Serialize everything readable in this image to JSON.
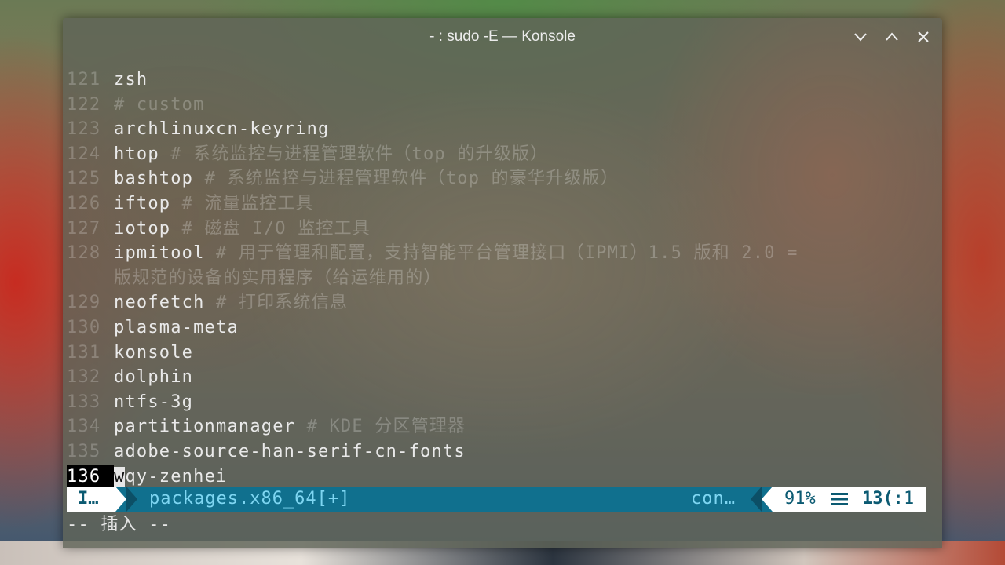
{
  "window": {
    "title": "- : sudo -E — Konsole",
    "controls": [
      "minimize",
      "maximize",
      "close"
    ]
  },
  "editor": {
    "lines": [
      {
        "num": "121",
        "text": "zsh",
        "comment": ""
      },
      {
        "num": "122",
        "text": "",
        "comment": "# custom"
      },
      {
        "num": "123",
        "text": "archlinuxcn-keyring",
        "comment": ""
      },
      {
        "num": "124",
        "text": "htop",
        "comment": " # 系统监控与进程管理软件（top 的升级版）"
      },
      {
        "num": "125",
        "text": "bashtop",
        "comment": " # 系统监控与进程管理软件（top 的豪华升级版）"
      },
      {
        "num": "126",
        "text": "iftop",
        "comment": " # 流量监控工具"
      },
      {
        "num": "127",
        "text": "iotop",
        "comment": " # 磁盘 I/O 监控工具"
      },
      {
        "num": "128",
        "text": "ipmitool",
        "comment": " # 用于管理和配置，支持智能平台管理接口（IPMI）1.5 版和 2.0 ="
      },
      {
        "num": "",
        "text": "",
        "comment": "版规范的设备的实用程序（给运维用的）"
      },
      {
        "num": "129",
        "text": "neofetch",
        "comment": " # 打印系统信息"
      },
      {
        "num": "130",
        "text": "plasma-meta",
        "comment": ""
      },
      {
        "num": "131",
        "text": "konsole",
        "comment": ""
      },
      {
        "num": "132",
        "text": "dolphin",
        "comment": ""
      },
      {
        "num": "133",
        "text": "ntfs-3g",
        "comment": ""
      },
      {
        "num": "134",
        "text": "partitionmanager",
        "comment": " # KDE 分区管理器"
      },
      {
        "num": "135",
        "text": "adobe-source-han-serif-cn-fonts",
        "comment": ""
      }
    ],
    "current_line": {
      "num": "136",
      "cursor_char": "w",
      "rest": "qy-zenhei"
    }
  },
  "statusline": {
    "mode": "I…",
    "filename": "packages.x86_64[+]",
    "filetype": "con…",
    "percent": "91%",
    "line_col_line": "13(",
    "line_col_col": ":1"
  },
  "cmdline": {
    "text": "-- 插入 --"
  },
  "colors": {
    "statusline_bg": "#10708e",
    "statusline_fg": "#7ed6f2"
  }
}
